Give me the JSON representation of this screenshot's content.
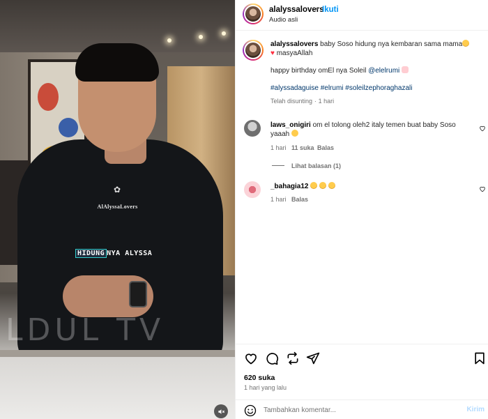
{
  "video": {
    "watermark_text": "AlAlyssaLovers",
    "caption_highlight": "HIDUNG",
    "caption_rest": "NYA ALYSSA",
    "channel_watermark": "LDUL TV",
    "mute_icon": "speaker-muted-icon"
  },
  "header": {
    "username": "alalyssalovers",
    "separator": "•",
    "follow_label": "Ikuti",
    "subtitle": "Audio asli"
  },
  "caption": {
    "username": "alalyssalovers",
    "text_line1": "baby Soso hidung nya kembaran sama mama",
    "text_line1b": "masyaAllah",
    "text_line2_start": "happy birthday omEl nya Soleil",
    "mention": "@elelrumi",
    "hashtags": "#alyssadaguise #elrumi #soleilzephoraghazali",
    "edited": "Telah disunting",
    "edited_sep": "·",
    "edited_time": "1 hari"
  },
  "comments": [
    {
      "username": "laws_onigiri",
      "text": "om el tolong oleh2 italy temen buat baby Soso yaaah",
      "time": "1 hari",
      "likes": "11 suka",
      "reply": "Balas",
      "view_replies": "Lihat balasan (1)"
    },
    {
      "username": "_bahagia12",
      "text": "",
      "time": "1 hari",
      "reply": "Balas"
    }
  ],
  "actions": {
    "likes": "620 suka",
    "time_ago": "1 hari yang lalu"
  },
  "composer": {
    "placeholder": "Tambahkan komentar...",
    "send_label": "Kirim"
  },
  "colors": {
    "accent_blue": "#0095f6",
    "link_blue": "#00376b",
    "send_disabled": "#b3dbff",
    "heart_red": "#ff3040"
  }
}
